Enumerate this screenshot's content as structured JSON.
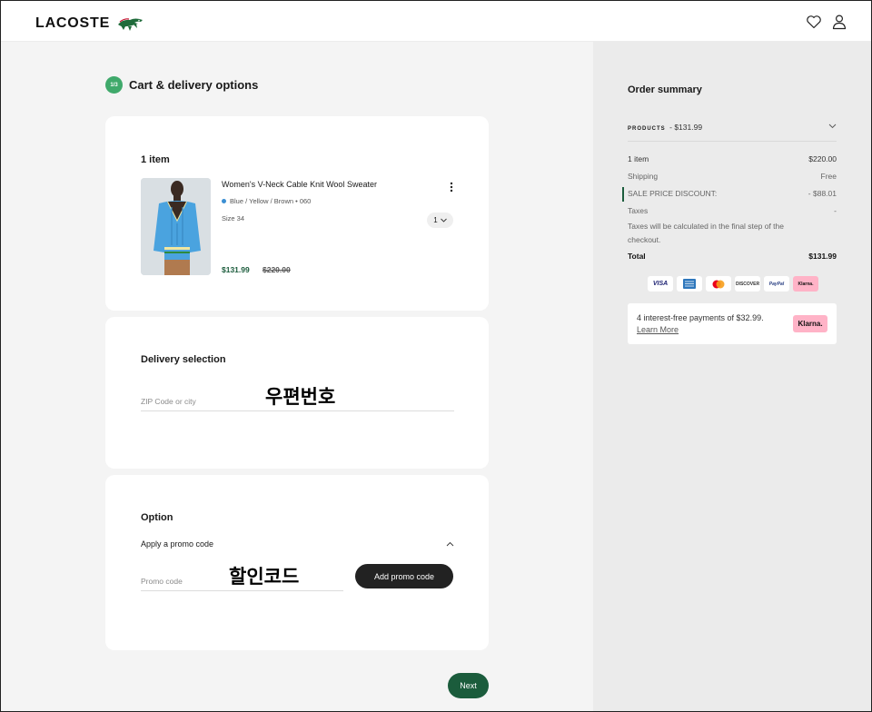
{
  "header": {
    "logo_text": "LACOSTE",
    "icons": [
      "wishlist-heart-icon",
      "account-user-icon"
    ]
  },
  "step": {
    "badge": "1/3",
    "title": "Cart & delivery options"
  },
  "cart": {
    "heading": "1 item",
    "product": {
      "name": "Women's V-Neck Cable Knit Wool Sweater",
      "color": "Blue / Yellow / Brown • 060",
      "color_dot": "#3b8fd3",
      "size": "Size 34",
      "quantity": "1",
      "sale_price": "$131.99",
      "original_price": "$220.00"
    }
  },
  "delivery": {
    "heading": "Delivery selection",
    "zip_placeholder": "ZIP Code or city",
    "overlay_text": "우편번호"
  },
  "option": {
    "heading": "Option",
    "promo_toggle": "Apply a promo code",
    "promo_placeholder": "Promo code",
    "overlay_text": "할인코드",
    "add_button": "Add promo code"
  },
  "next_button": "Next",
  "summary": {
    "title": "Order summary",
    "products_label": "PRODUCTS",
    "products_value": "- $131.99",
    "rows": [
      {
        "label": "1 item",
        "value": "$220.00"
      },
      {
        "label": "Shipping",
        "value": "Free"
      },
      {
        "label": "SALE PRICE DISCOUNT:",
        "value": "- $88.01"
      },
      {
        "label": "Taxes",
        "value": "-"
      }
    ],
    "tax_note": "Taxes will be calculated in the final step of the checkout.",
    "total_label": "Total",
    "total_value": "$131.99",
    "payment_methods": [
      "VISA",
      "AMEX",
      "Mastercard",
      "DISCOVER",
      "PayPal",
      "Klarna."
    ],
    "klarna": {
      "text": "4 interest-free payments of $32.99.",
      "link": "Learn More",
      "badge": "Klarna."
    }
  },
  "colors": {
    "brand_green": "#1b5c3c",
    "step_green": "#3fa96b",
    "klarna_pink": "#ffb3c7"
  }
}
